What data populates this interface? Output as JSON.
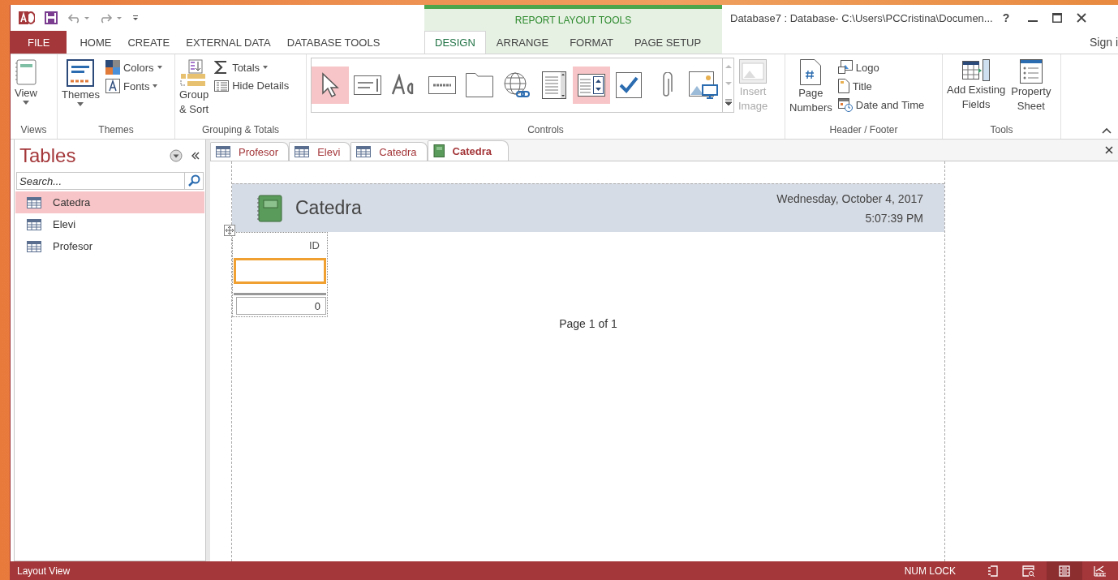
{
  "window": {
    "title": "Database7 : Database- C:\\Users\\PCCristina\\Documen...",
    "context_label": "REPORT LAYOUT TOOLS",
    "help": "?",
    "sign_in": "Sign i"
  },
  "ribbon_tabs": [
    {
      "label": "FILE",
      "kind": "file",
      "selected": false
    },
    {
      "label": "HOME",
      "kind": "normal",
      "selected": false
    },
    {
      "label": "CREATE",
      "kind": "normal",
      "selected": false
    },
    {
      "label": "EXTERNAL DATA",
      "kind": "normal",
      "selected": false
    },
    {
      "label": "DATABASE TOOLS",
      "kind": "normal",
      "selected": false
    },
    {
      "label": "DESIGN",
      "kind": "contextual",
      "selected": true
    },
    {
      "label": "ARRANGE",
      "kind": "contextual",
      "selected": false
    },
    {
      "label": "FORMAT",
      "kind": "contextual",
      "selected": false
    },
    {
      "label": "PAGE SETUP",
      "kind": "contextual",
      "selected": false
    }
  ],
  "ribbon": {
    "views": {
      "label": "Views",
      "view": "View"
    },
    "themes": {
      "label": "Themes",
      "themes": "Themes",
      "colors": "Colors",
      "fonts": "Fonts"
    },
    "grouping": {
      "label": "Grouping & Totals",
      "group_sort": [
        "Group",
        "& Sort"
      ],
      "totals": "Totals",
      "hide_details": "Hide Details"
    },
    "controls": {
      "label": "Controls",
      "items": [
        {
          "kind": "pointer",
          "selected": true
        },
        {
          "kind": "textbox",
          "selected": false
        },
        {
          "kind": "label",
          "selected": false
        },
        {
          "kind": "button",
          "selected": false
        },
        {
          "kind": "tab",
          "selected": false
        },
        {
          "kind": "hyperlink",
          "selected": false
        },
        {
          "kind": "listbox",
          "selected": false
        },
        {
          "kind": "combobox",
          "selected": true
        },
        {
          "kind": "checkbox",
          "selected": false
        },
        {
          "kind": "attachment",
          "selected": false
        },
        {
          "kind": "object",
          "selected": false
        }
      ],
      "insert_image": {
        "label": [
          "Insert",
          "Image"
        ],
        "disabled": true
      }
    },
    "header_footer": {
      "label": "Header / Footer",
      "page_numbers": [
        "Page",
        "Numbers"
      ],
      "logo": "Logo",
      "title": "Title",
      "date_time": "Date and Time"
    },
    "tools": {
      "label": "Tools",
      "add_fields": [
        "Add Existing",
        "Fields"
      ],
      "property_sheet": [
        "Property",
        "Sheet"
      ]
    }
  },
  "nav": {
    "title": "Tables",
    "search": {
      "placeholder": "Search..."
    },
    "items": [
      {
        "label": "Catedra",
        "selected": true
      },
      {
        "label": "Elevi",
        "selected": false
      },
      {
        "label": "Profesor",
        "selected": false
      }
    ]
  },
  "doc_tabs": [
    {
      "label": "Profesor",
      "kind": "table",
      "selected": false
    },
    {
      "label": "Elevi",
      "kind": "table",
      "selected": false
    },
    {
      "label": "Catedra",
      "kind": "table",
      "selected": false
    },
    {
      "label": "Catedra",
      "kind": "report",
      "selected": true
    }
  ],
  "report": {
    "title": "Catedra",
    "date": "Wednesday, October 4, 2017",
    "time": "5:07:39 PM",
    "column_header": "ID",
    "id_box": {
      "selected": true
    },
    "total": "0",
    "page_footer": "Page 1 of 1"
  },
  "status_bar": {
    "mode": "Layout View",
    "num_lock": "NUM LOCK",
    "views": [
      {
        "kind": "report",
        "selected": false
      },
      {
        "kind": "preview",
        "selected": false
      },
      {
        "kind": "layout",
        "selected": true
      },
      {
        "kind": "design",
        "selected": false
      }
    ]
  }
}
